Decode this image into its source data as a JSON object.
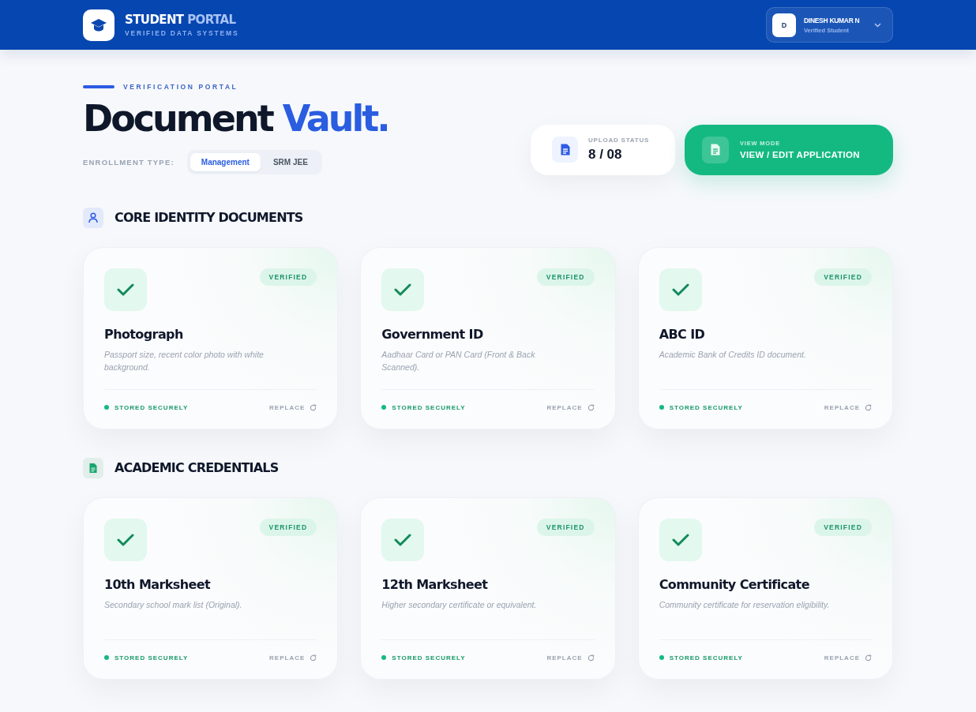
{
  "header": {
    "brand_primary": "STUDENT",
    "brand_accent": "PORTAL",
    "tagline": "VERIFIED DATA SYSTEMS",
    "user": {
      "initial": "D",
      "name": "DINESH KUMAR N",
      "role": "Verified Student"
    }
  },
  "hero": {
    "eyebrow": "VERIFICATION PORTAL",
    "title_main": "Document",
    "title_accent": "Vault.",
    "enrollment_label": "ENROLLMENT TYPE:",
    "enrollment_options": [
      {
        "label": "Management",
        "selected": true
      },
      {
        "label": "SRM JEE",
        "selected": false
      }
    ],
    "upload_status": {
      "label": "UPLOAD STATUS",
      "value": "8 / 08"
    },
    "view_mode": {
      "label": "VIEW MODE",
      "action": "VIEW / EDIT APPLICATION"
    }
  },
  "sections": [
    {
      "kind": "identity",
      "title": "CORE IDENTITY DOCUMENTS",
      "documents": [
        {
          "name": "Photograph",
          "description": "Passport size, recent color photo with white background.",
          "verified": true,
          "badge": "VERIFIED",
          "status": "STORED SECURELY",
          "action": "REPLACE"
        },
        {
          "name": "Government ID",
          "description": "Aadhaar Card or PAN Card (Front & Back Scanned).",
          "verified": true,
          "badge": "VERIFIED",
          "status": "STORED SECURELY",
          "action": "REPLACE"
        },
        {
          "name": "ABC ID",
          "description": "Academic Bank of Credits ID document.",
          "verified": true,
          "badge": "VERIFIED",
          "status": "STORED SECURELY",
          "action": "REPLACE"
        }
      ]
    },
    {
      "kind": "academic",
      "title": "ACADEMIC CREDENTIALS",
      "documents": [
        {
          "name": "10th Marksheet",
          "description": "Secondary school mark list (Original).",
          "verified": true,
          "badge": "VERIFIED",
          "status": "STORED SECURELY",
          "action": "REPLACE"
        },
        {
          "name": "12th Marksheet",
          "description": "Higher secondary certificate or equivalent.",
          "verified": true,
          "badge": "VERIFIED",
          "status": "STORED SECURELY",
          "action": "REPLACE"
        },
        {
          "name": "Community Certificate",
          "description": "Community certificate for reservation eligibility.",
          "verified": true,
          "badge": "VERIFIED",
          "status": "STORED SECURELY",
          "action": "REPLACE"
        }
      ]
    }
  ]
}
